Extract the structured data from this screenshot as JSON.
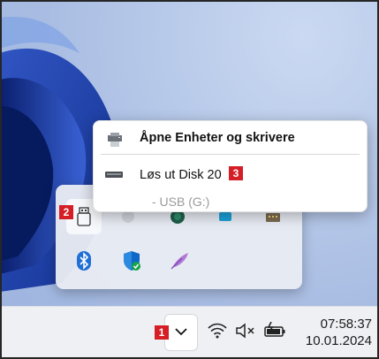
{
  "context_menu": {
    "open_devices_label": "Åpne Enheter og skrivere",
    "eject_label": "Løs ut Disk 20",
    "sub_item_label": "- USB (G:)"
  },
  "markers": {
    "chevron": "1",
    "usb_tray_icon": "2",
    "eject_item": "3"
  },
  "taskbar": {
    "time": "07:58:37",
    "date": "10.01.2024"
  },
  "tray_icons": [
    "usb-drive-icon",
    "blurred-icon",
    "green-app-icon",
    "blue-app-icon",
    "folder-icon",
    "bluetooth-icon",
    "windows-security-icon",
    "feather-icon"
  ],
  "colors": {
    "marker_red": "#d51e25",
    "accent_blue": "#1f6fd6"
  }
}
